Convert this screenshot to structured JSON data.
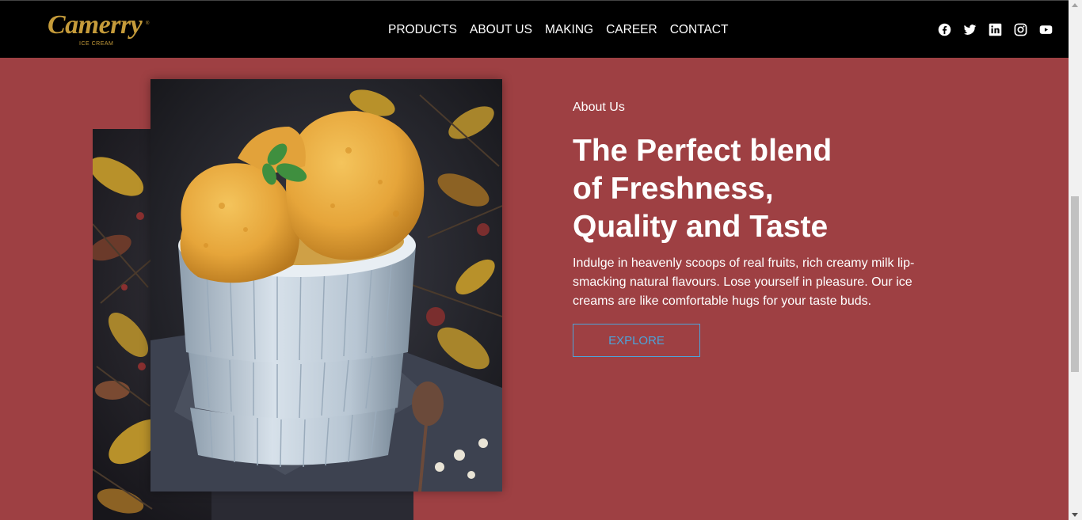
{
  "brand": {
    "name": "Camerry",
    "trademark": "®",
    "tagline": "ICE CREAM",
    "color": "#c59b3a"
  },
  "nav": {
    "items": [
      {
        "label": "PRODUCTS"
      },
      {
        "label": "ABOUT US"
      },
      {
        "label": "MAKING"
      },
      {
        "label": "CAREER"
      },
      {
        "label": "CONTACT"
      }
    ]
  },
  "social": [
    "facebook-icon",
    "twitter-icon",
    "linkedin-icon",
    "instagram-icon",
    "youtube-icon"
  ],
  "about": {
    "label": "About Us",
    "heading": "The Perfect blend of Freshness, Quality and Taste",
    "description": "Indulge in heavenly scoops of real fruits, rich creamy milk lip-smacking natural flavours. Lose yourself in pleasure. Our ice creams are like comfortable hugs for your taste buds.",
    "cta": "EXPLORE"
  },
  "colors": {
    "background": "#9e4043",
    "navbar": "#000000",
    "accent": "#4da3d9"
  }
}
